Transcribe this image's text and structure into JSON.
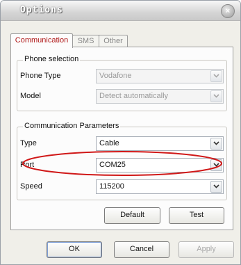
{
  "window": {
    "title": "Options",
    "close_symbol": "×"
  },
  "tabs": [
    {
      "label": "Communication",
      "active": true
    },
    {
      "label": "SMS",
      "active": false
    },
    {
      "label": "Other",
      "active": false
    }
  ],
  "phone_selection": {
    "title": "Phone selection",
    "phone_type": {
      "label": "Phone Type",
      "value": "Vodafone",
      "enabled": false
    },
    "model": {
      "label": "Model",
      "value": "Detect automatically",
      "enabled": false
    }
  },
  "communication_parameters": {
    "title": "Communication Parameters",
    "type": {
      "label": "Type",
      "value": "Cable"
    },
    "port": {
      "label": "Port",
      "value": "COM25"
    },
    "speed": {
      "label": "Speed",
      "value": "115200"
    }
  },
  "panel_buttons": {
    "default_label": "Default",
    "test_label": "Test"
  },
  "dialog_buttons": {
    "ok_label": "OK",
    "cancel_label": "Cancel",
    "apply_label": "Apply"
  },
  "colors": {
    "tab_active_text": "#b01818",
    "highlight_ellipse": "#d01818"
  }
}
